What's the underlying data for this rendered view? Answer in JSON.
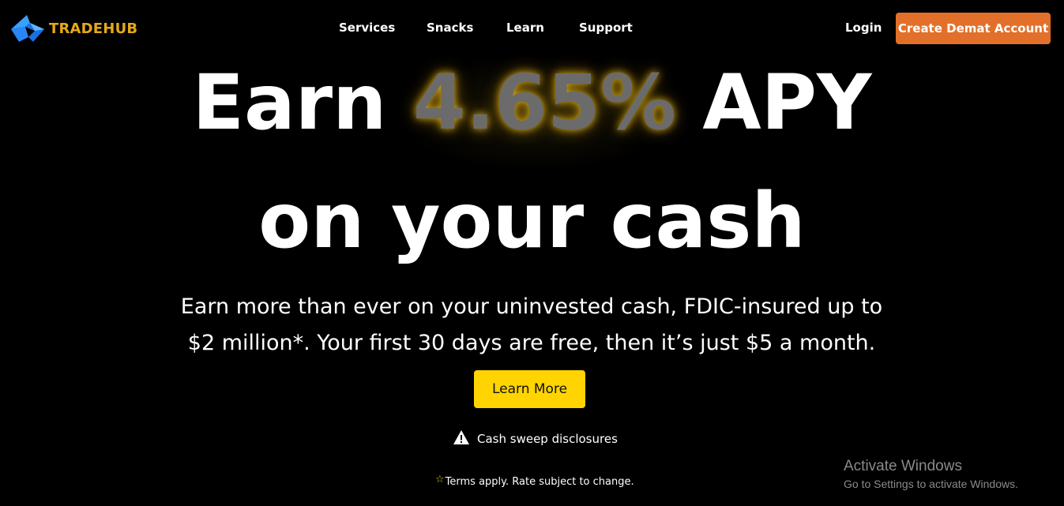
{
  "brand": {
    "name": "TRADEHUB",
    "logo_icon": "blue-arrow-logo-icon",
    "name_color": "#e6a817",
    "logo_color": "#1e90ff"
  },
  "nav": {
    "items": [
      {
        "label": "Services"
      },
      {
        "label": "Snacks"
      },
      {
        "label": "Learn"
      },
      {
        "label": "Support"
      }
    ],
    "login_label": "Login",
    "cta_label": "Create Demat Account",
    "cta_color": "#e2702a"
  },
  "hero": {
    "line1_prefix": "Earn",
    "rate": "4.65%",
    "line1_suffix": "APY",
    "line2": "on your cash",
    "subtext": "Earn more than ever on your uninvested cash, FDIC-insured up to $2 million*. Your first 30 days are free, then it’s just $5 a month.",
    "button_label": "Learn More",
    "button_color": "#ffd400",
    "disclosure_icon": "warning-icon",
    "disclosure_label": "Cash sweep disclosures",
    "terms_icon": "star-icon",
    "terms_text": "Terms apply. Rate subject to change."
  },
  "watermark": {
    "title": "Activate Windows",
    "subtitle": "Go to Settings to activate Windows."
  }
}
